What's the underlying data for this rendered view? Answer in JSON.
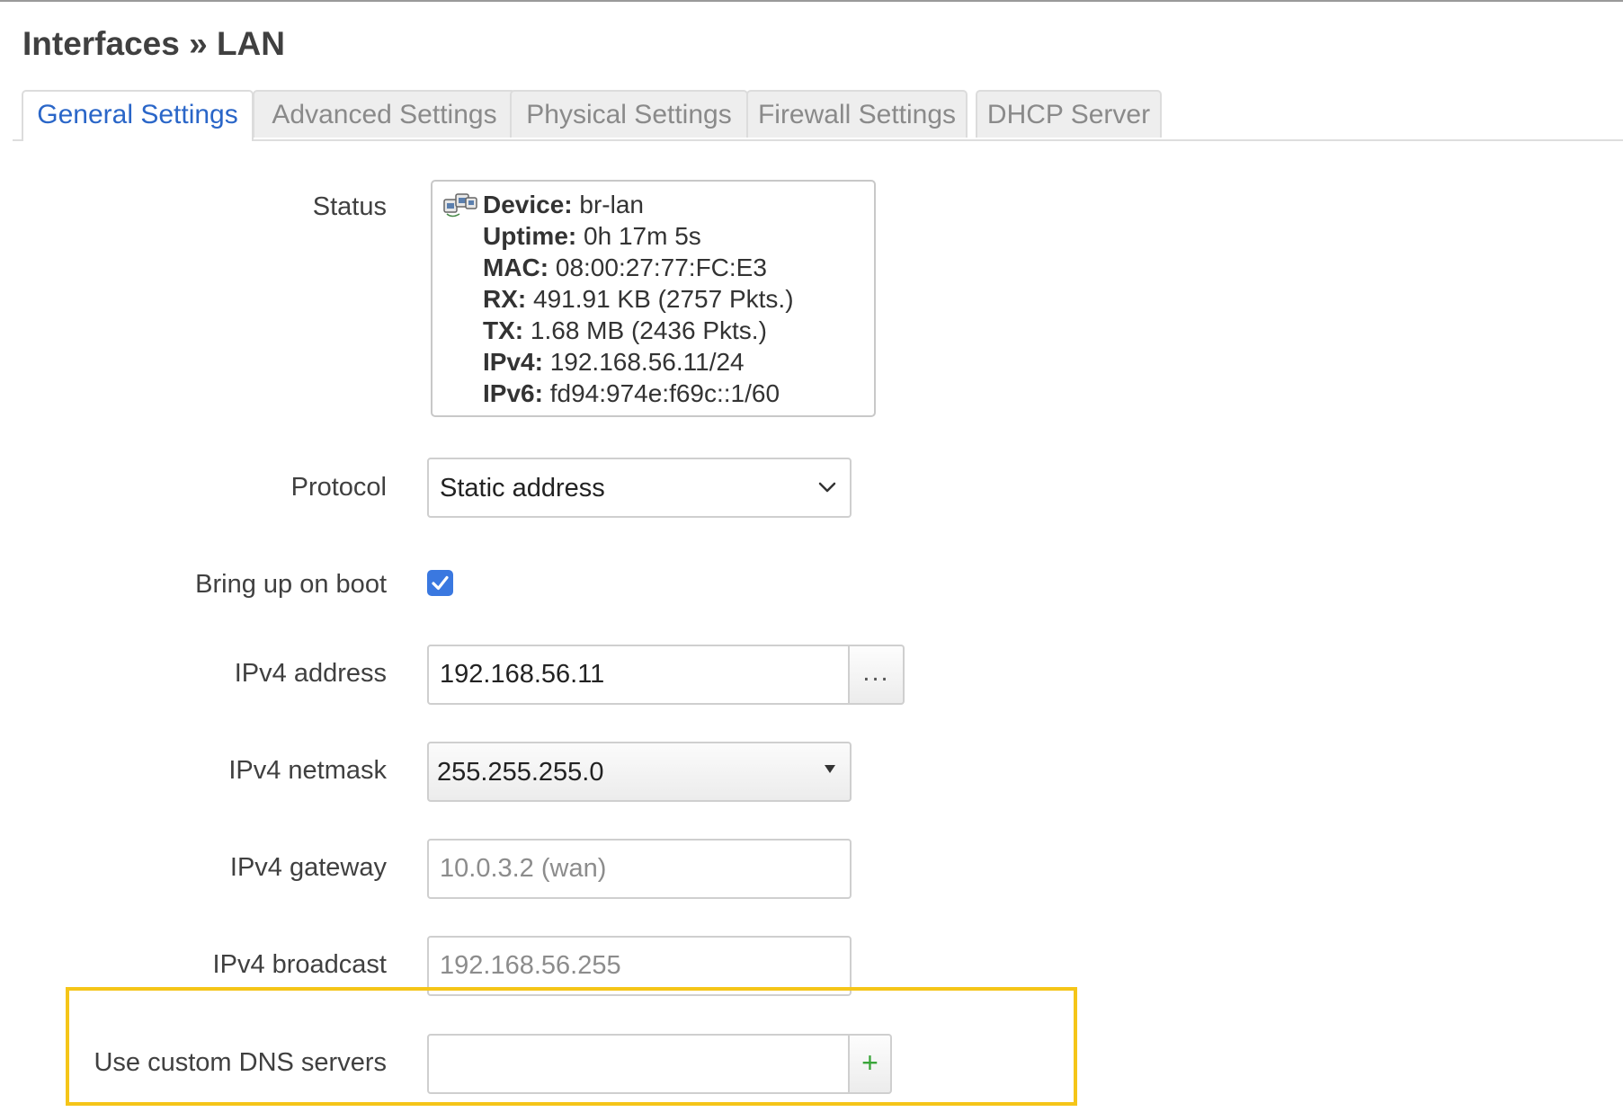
{
  "page": {
    "title": "Interfaces » LAN"
  },
  "tabs": [
    {
      "label": "General Settings",
      "active": true
    },
    {
      "label": "Advanced Settings",
      "active": false
    },
    {
      "label": "Physical Settings",
      "active": false
    },
    {
      "label": "Firewall Settings",
      "active": false
    },
    {
      "label": "DHCP Server",
      "active": false
    }
  ],
  "status": {
    "label": "Status",
    "icon": "network-ports-icon",
    "lines": [
      {
        "key": "Device:",
        "value": "br-lan"
      },
      {
        "key": "Uptime:",
        "value": "0h 17m 5s"
      },
      {
        "key": "MAC:",
        "value": "08:00:27:77:FC:E3"
      },
      {
        "key": "RX:",
        "value": "491.91 KB (2757 Pkts.)"
      },
      {
        "key": "TX:",
        "value": "1.68 MB (2436 Pkts.)"
      },
      {
        "key": "IPv4:",
        "value": "192.168.56.11/24"
      },
      {
        "key": "IPv6:",
        "value": "fd94:974e:f69c::1/60"
      }
    ]
  },
  "protocol": {
    "label": "Protocol",
    "value": "Static address"
  },
  "boot": {
    "label": "Bring up on boot",
    "checked": true
  },
  "ipv4_address": {
    "label": "IPv4 address",
    "value": "192.168.56.11",
    "button": "..."
  },
  "ipv4_netmask": {
    "label": "IPv4 netmask",
    "value": "255.255.255.0"
  },
  "ipv4_gateway": {
    "label": "IPv4 gateway",
    "placeholder": "10.0.3.2 (wan)"
  },
  "ipv4_broadcast": {
    "label": "IPv4 broadcast",
    "placeholder": "192.168.56.255"
  },
  "dns": {
    "label": "Use custom DNS servers",
    "value": "",
    "button": "+"
  },
  "colors": {
    "accent": "#2a66c8",
    "checkbox": "#3a78e0",
    "highlight": "#f5c518",
    "add_button": "#3aa53a"
  }
}
